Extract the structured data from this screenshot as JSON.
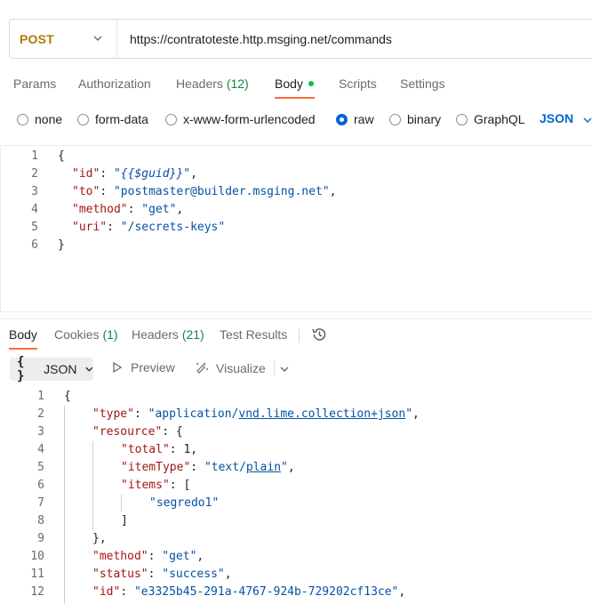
{
  "request": {
    "method": "POST",
    "url": "https://contratoteste.http.msging.net/commands"
  },
  "request_tabs": [
    {
      "label": "Params",
      "count": "",
      "active": false
    },
    {
      "label": "Authorization",
      "count": "",
      "active": false
    },
    {
      "label": "Headers",
      "count": "(12)",
      "active": false
    },
    {
      "label": "Body",
      "count": "",
      "active": true
    },
    {
      "label": "Scripts",
      "count": "",
      "active": false
    },
    {
      "label": "Settings",
      "count": "",
      "active": false
    }
  ],
  "body_types": [
    {
      "label": "none",
      "checked": false
    },
    {
      "label": "form-data",
      "checked": false
    },
    {
      "label": "x-www-form-urlencoded",
      "checked": false
    },
    {
      "label": "raw",
      "checked": true
    },
    {
      "label": "binary",
      "checked": false
    },
    {
      "label": "GraphQL",
      "checked": false
    }
  ],
  "raw_language": "JSON",
  "request_body_lines": [
    {
      "n": "1",
      "text": "{"
    },
    {
      "n": "2",
      "key": "\"id\"",
      "value": "\"{{$guid}}\"",
      "tail": ","
    },
    {
      "n": "3",
      "key": "\"to\"",
      "value": "\"postmaster@builder.msging.net\"",
      "tail": ","
    },
    {
      "n": "4",
      "key": "\"method\"",
      "value": "\"get\"",
      "tail": ","
    },
    {
      "n": "5",
      "key": "\"uri\"",
      "value": "\"/secrets-keys\"",
      "tail": ""
    },
    {
      "n": "6",
      "text": "}"
    }
  ],
  "response_tabs": [
    {
      "label": "Body",
      "count": "",
      "active": true
    },
    {
      "label": "Cookies",
      "count": "(1)",
      "active": false
    },
    {
      "label": "Headers",
      "count": "(21)",
      "active": false
    },
    {
      "label": "Test Results",
      "count": "",
      "active": false
    }
  ],
  "response_toolbar": {
    "format_braces": "{ }",
    "format_label": "JSON",
    "preview_label": "Preview",
    "visualize_label": "Visualize"
  },
  "response_lines": [
    {
      "n": "1",
      "text": "{"
    },
    {
      "n": "2",
      "key": "\"type\"",
      "value_pre": "\"application/",
      "value_link": "vnd.lime.collection+json",
      "value_post": "\"",
      "tail": ","
    },
    {
      "n": "3",
      "key": "\"resource\"",
      "text_after": ": {"
    },
    {
      "n": "4",
      "key": "\"total\"",
      "number": "1",
      "tail": ","
    },
    {
      "n": "5",
      "key": "\"itemType\"",
      "value_pre": "\"text/",
      "value_link": "plain",
      "value_post": "\"",
      "tail": ","
    },
    {
      "n": "6",
      "key": "\"items\"",
      "text_after": ": ["
    },
    {
      "n": "7",
      "value": "\"segredo1\""
    },
    {
      "n": "8",
      "text": "]"
    },
    {
      "n": "9",
      "text": "},"
    },
    {
      "n": "10",
      "key": "\"method\"",
      "value": "\"get\"",
      "tail": ","
    },
    {
      "n": "11",
      "key": "\"status\"",
      "value": "\"success\"",
      "tail": ","
    },
    {
      "n": "12",
      "key": "\"id\"",
      "value": "\"e3325b45-291a-4767-924b-729202cf13ce\"",
      "tail": ","
    }
  ],
  "colors": {
    "method": "#ad7a03",
    "json_key": "#a31515",
    "json_string": "#0451a5",
    "active_tab_indicator": "#ff6c37",
    "count_green": "#0f8a41",
    "link_blue": "#0265d2"
  },
  "icons": [
    "chevron-down-icon",
    "radio-icon",
    "history-icon",
    "play-icon",
    "visualize-icon"
  ]
}
